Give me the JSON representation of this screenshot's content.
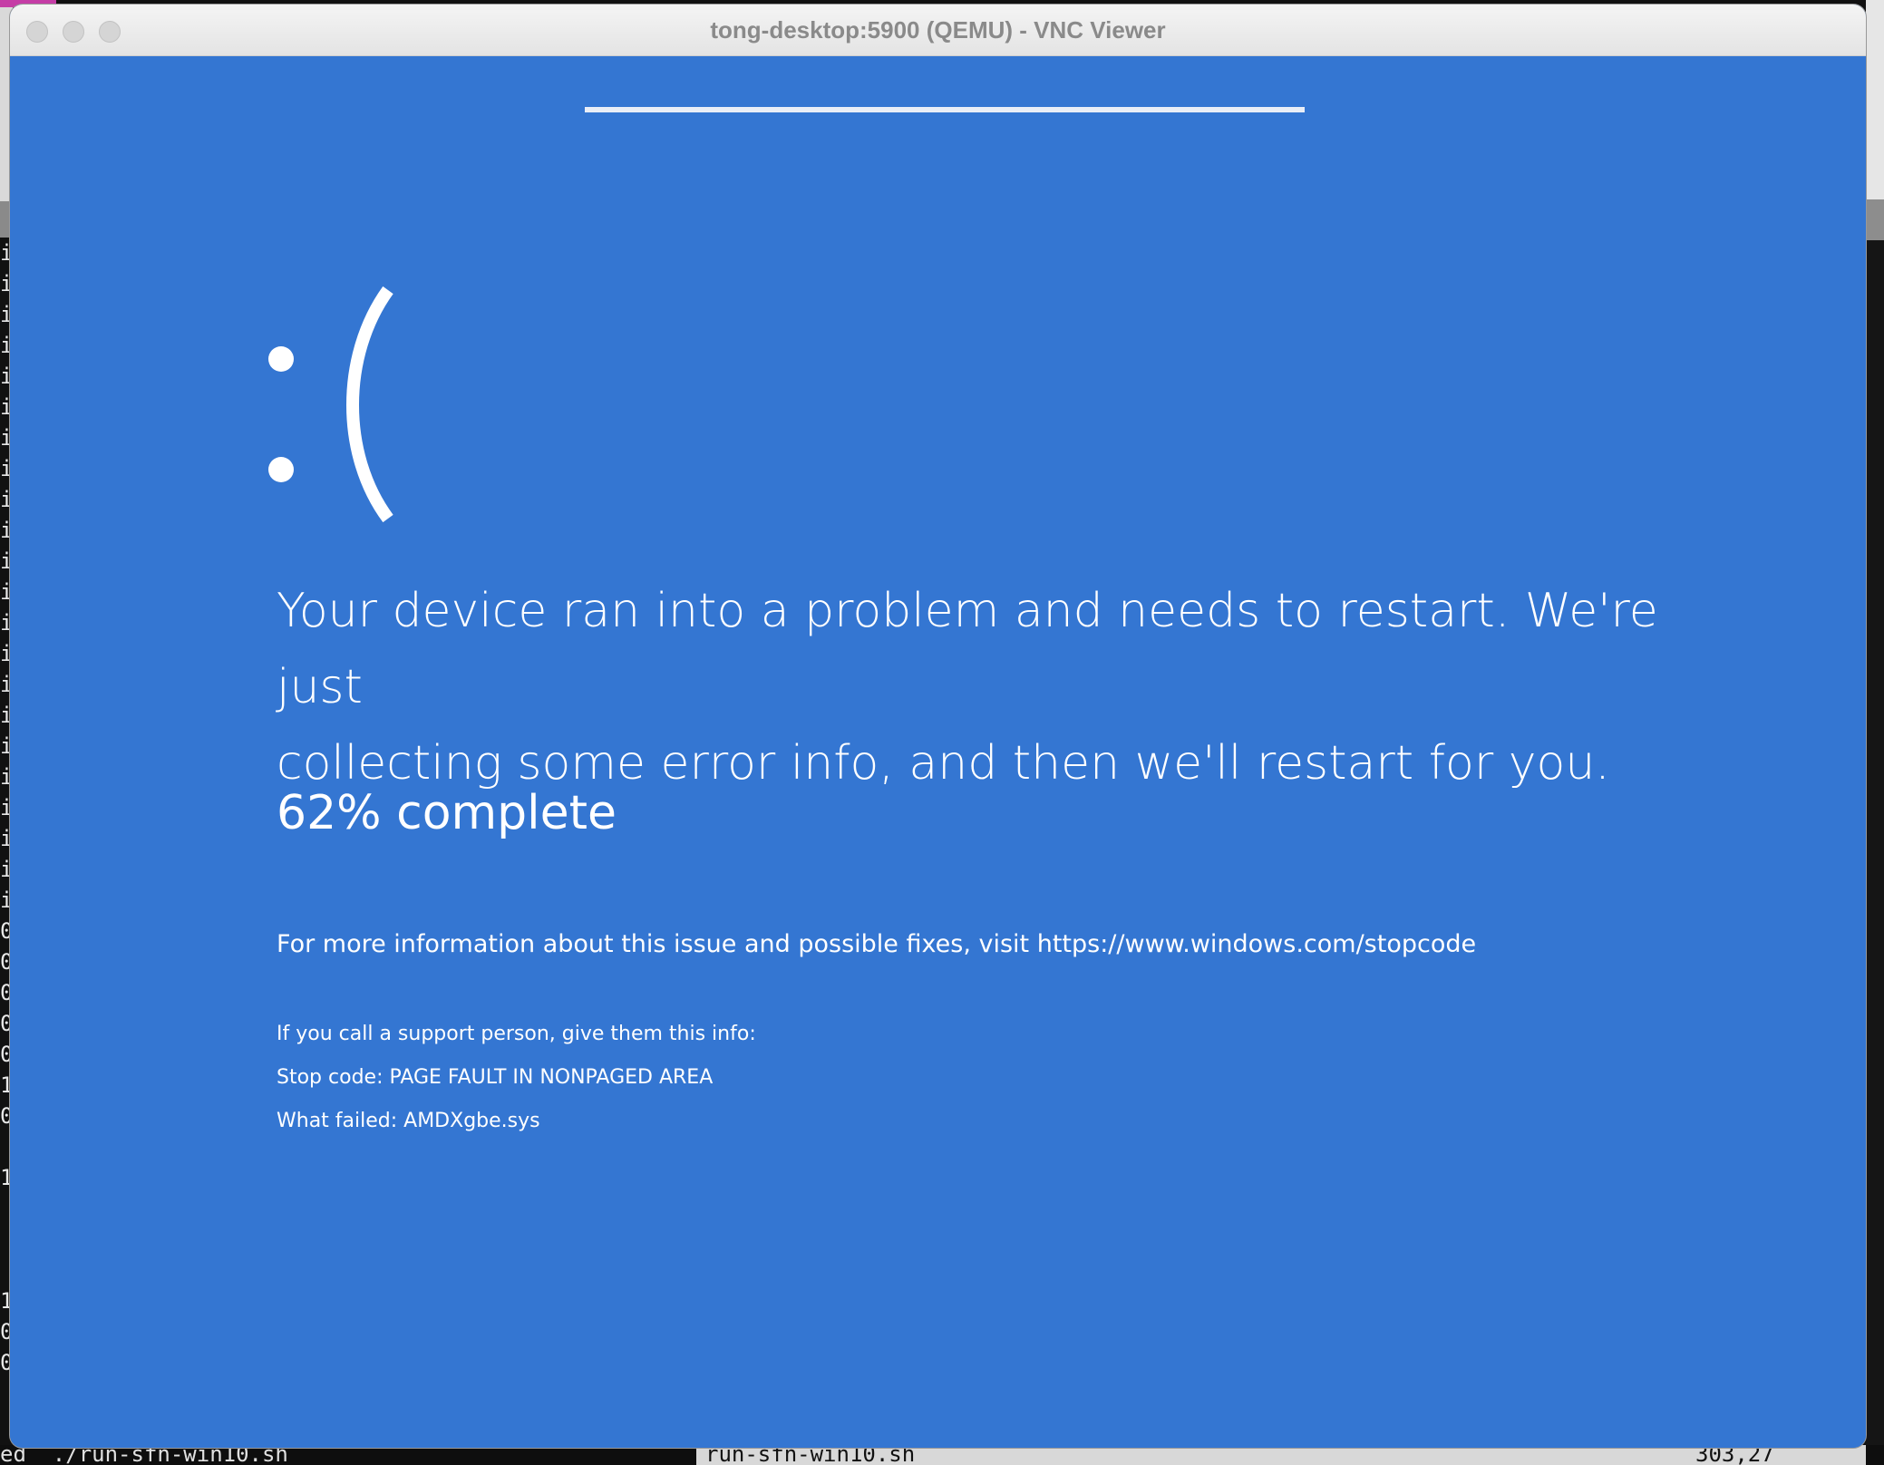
{
  "window": {
    "title": "tong-desktop:5900 (QEMU) - VNC Viewer"
  },
  "bsod": {
    "face": ":(",
    "headline_line1": "Your device ran into a problem and needs to restart. We're just",
    "headline_line2": "collecting some error info, and then we'll restart for you.",
    "progress_text": "62% complete",
    "progress_value": 62,
    "more_info": "For more information about this issue and possible fixes, visit https://www.windows.com/stopcode",
    "support_intro": "If you call a support person, give them this info:",
    "stop_code": "Stop code: PAGE FAULT IN NONPAGED AREA",
    "what_failed": "What failed: AMDXgbe.sys"
  },
  "background_terminal": {
    "left_column": "i\ni\ni\ni\ni\ni\ni\ni\ni\ni\ni\ni\ni\ni\ni\ni\ni\ni\ni\ni\ni\ni\n0\n0\n0\n0\n0\n1\n0\n\n1\n\n\n\n1\n0\n0",
    "status_left": "ed  ./run-sfn-win10.sh",
    "status_mid": "run-sfn-win10.sh",
    "status_right": "303,27"
  },
  "colors": {
    "bsod_blue": "#3476d2",
    "text": "#ffffff"
  }
}
